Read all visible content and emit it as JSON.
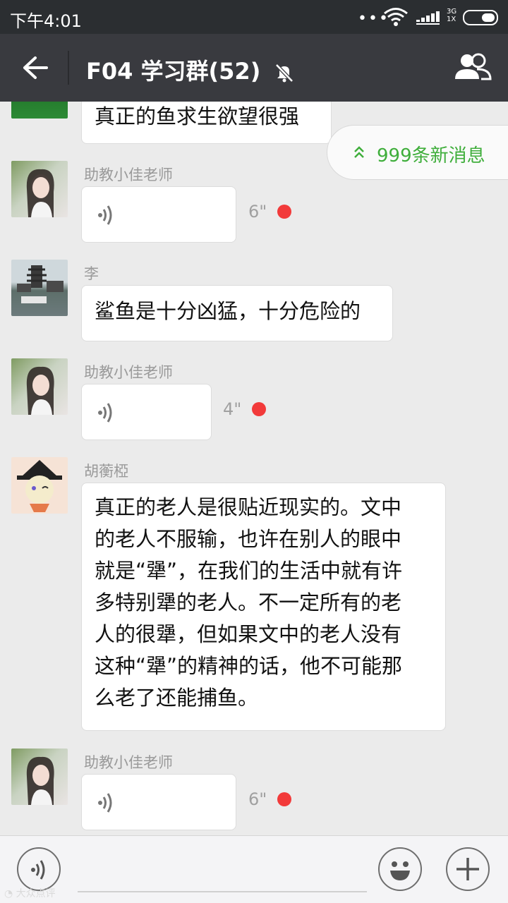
{
  "status_bar": {
    "time": "下午4:01",
    "network_top": "3G",
    "network_bottom": "1X"
  },
  "header": {
    "title": "F04 学习群(52)",
    "back_icon": "back-arrow-icon",
    "mute_icon": "bell-muted-icon",
    "members_icon": "group-members-icon"
  },
  "new_messages_banner": {
    "label": "999条新消息",
    "color": "#3fae3b"
  },
  "messages": [
    {
      "type": "text",
      "sender": "",
      "text": "真正的鱼求生欲望很强"
    },
    {
      "type": "voice",
      "sender": "助教小佳老师",
      "duration": "6\"",
      "unread": true
    },
    {
      "type": "text",
      "sender": "李",
      "text": "鲨鱼是十分凶猛，十分危险的"
    },
    {
      "type": "voice",
      "sender": "助教小佳老师",
      "duration": "4\"",
      "unread": true
    },
    {
      "type": "text",
      "sender": "胡蘅椏",
      "lines": [
        "真正的老人是很贴近现实的。文中",
        "的老人不服输，也许在别人的眼中",
        "就是“犟”，在我们的生活中就有许",
        "多特别犟的老人。不一定所有的老",
        "人的很犟，但如果文中的老人没有",
        "这种“犟”的精神的话，他不可能那",
        "么老了还能捕鱼。"
      ]
    },
    {
      "type": "voice",
      "sender": "助教小佳老师",
      "duration": "6\"",
      "unread": true
    }
  ],
  "input_bar": {
    "voice_icon": "voice-mode-icon",
    "emoji_icon": "emoji-icon",
    "plus_icon": "plus-icon"
  },
  "watermark": "大众点评",
  "colors": {
    "status_bar": "#2b2e31",
    "title_bar": "#393a3f",
    "chat_bg": "#ebebeb",
    "unread_dot": "#f23a3a"
  }
}
